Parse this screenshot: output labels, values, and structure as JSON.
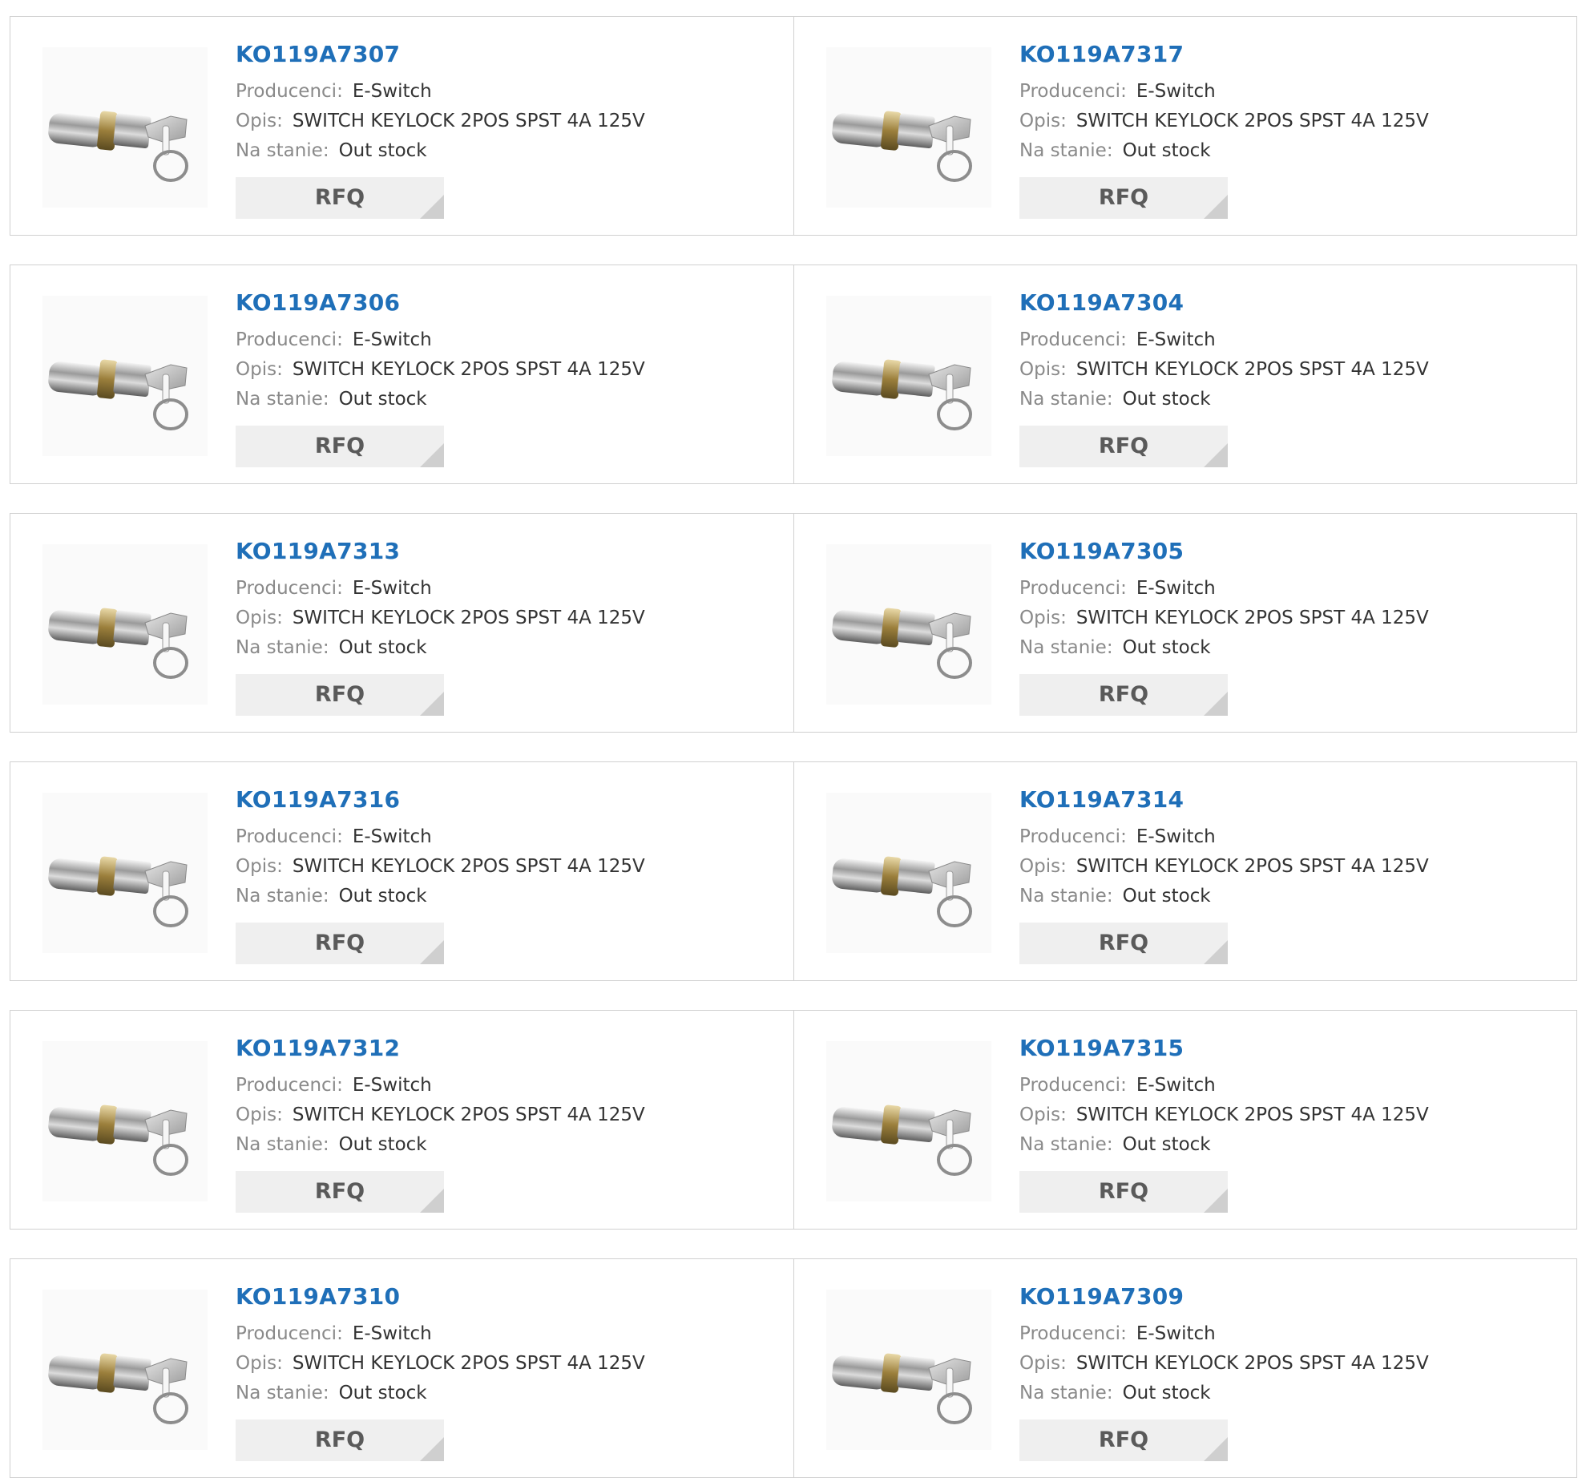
{
  "labels": {
    "manufacturer": "Producenci:",
    "description": "Opis:",
    "stock": "Na stanie:",
    "rfq": "RFQ"
  },
  "colors": {
    "part_link": "#1f6fb8",
    "label": "#8a8a8a",
    "value": "#333333",
    "rfq_bg": "#efefef",
    "rfq_text": "#5a5a5a",
    "border": "#d0d0d0"
  },
  "product_image_icon": "keylock-switch-image",
  "products": [
    {
      "part": "KO119A7307",
      "manufacturer": "E-Switch",
      "description": "SWITCH KEYLOCK 2POS SPST 4A 125V",
      "stock": "Out stock"
    },
    {
      "part": "KO119A7317",
      "manufacturer": "E-Switch",
      "description": "SWITCH KEYLOCK 2POS SPST 4A 125V",
      "stock": "Out stock"
    },
    {
      "part": "KO119A7306",
      "manufacturer": "E-Switch",
      "description": "SWITCH KEYLOCK 2POS SPST 4A 125V",
      "stock": "Out stock"
    },
    {
      "part": "KO119A7304",
      "manufacturer": "E-Switch",
      "description": "SWITCH KEYLOCK 2POS SPST 4A 125V",
      "stock": "Out stock"
    },
    {
      "part": "KO119A7313",
      "manufacturer": "E-Switch",
      "description": "SWITCH KEYLOCK 2POS SPST 4A 125V",
      "stock": "Out stock"
    },
    {
      "part": "KO119A7305",
      "manufacturer": "E-Switch",
      "description": "SWITCH KEYLOCK 2POS SPST 4A 125V",
      "stock": "Out stock"
    },
    {
      "part": "KO119A7316",
      "manufacturer": "E-Switch",
      "description": "SWITCH KEYLOCK 2POS SPST 4A 125V",
      "stock": "Out stock"
    },
    {
      "part": "KO119A7314",
      "manufacturer": "E-Switch",
      "description": "SWITCH KEYLOCK 2POS SPST 4A 125V",
      "stock": "Out stock"
    },
    {
      "part": "KO119A7312",
      "manufacturer": "E-Switch",
      "description": "SWITCH KEYLOCK 2POS SPST 4A 125V",
      "stock": "Out stock"
    },
    {
      "part": "KO119A7315",
      "manufacturer": "E-Switch",
      "description": "SWITCH KEYLOCK 2POS SPST 4A 125V",
      "stock": "Out stock"
    },
    {
      "part": "KO119A7310",
      "manufacturer": "E-Switch",
      "description": "SWITCH KEYLOCK 2POS SPST 4A 125V",
      "stock": "Out stock"
    },
    {
      "part": "KO119A7309",
      "manufacturer": "E-Switch",
      "description": "SWITCH KEYLOCK 2POS SPST 4A 125V",
      "stock": "Out stock"
    }
  ]
}
